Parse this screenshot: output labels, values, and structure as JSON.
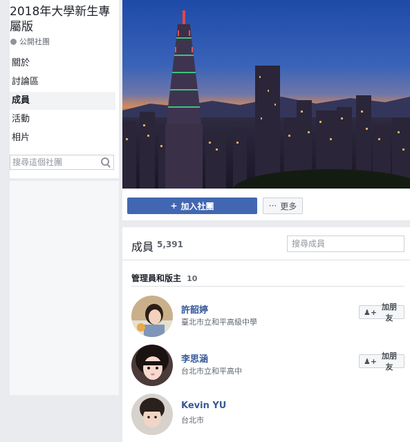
{
  "group": {
    "title": "2018年大學新生專屬版",
    "privacy_label": "公開社團"
  },
  "nav": {
    "items": [
      {
        "label": "關於"
      },
      {
        "label": "討論區"
      },
      {
        "label": "成員"
      },
      {
        "label": "活動"
      },
      {
        "label": "相片"
      }
    ],
    "active_index": 2
  },
  "sidebar_search": {
    "placeholder": "搜尋這個社團"
  },
  "actions": {
    "join_icon": "+",
    "join_label": "加入社團",
    "more_icon": "···",
    "more_label": "更多"
  },
  "members": {
    "title": "成員",
    "count": "5,391",
    "search_placeholder": "搜尋成員",
    "admins_title": "管理員和版主",
    "admins_count": "10",
    "list": [
      {
        "name": "許韶婷",
        "subtitle": "臺北市立和平高級中學",
        "button": "加朋友"
      },
      {
        "name": "李思涵",
        "subtitle": "台北市立和平高中",
        "button": "加朋友"
      },
      {
        "name": "Kevin YU",
        "subtitle": "台北市"
      }
    ]
  },
  "colors": {
    "primary": "#4267b2",
    "link": "#365899",
    "background": "#e9ebee"
  },
  "icons": {
    "privacy": "globe-icon",
    "search": "search-icon",
    "add_friend": "add-friend-icon"
  }
}
